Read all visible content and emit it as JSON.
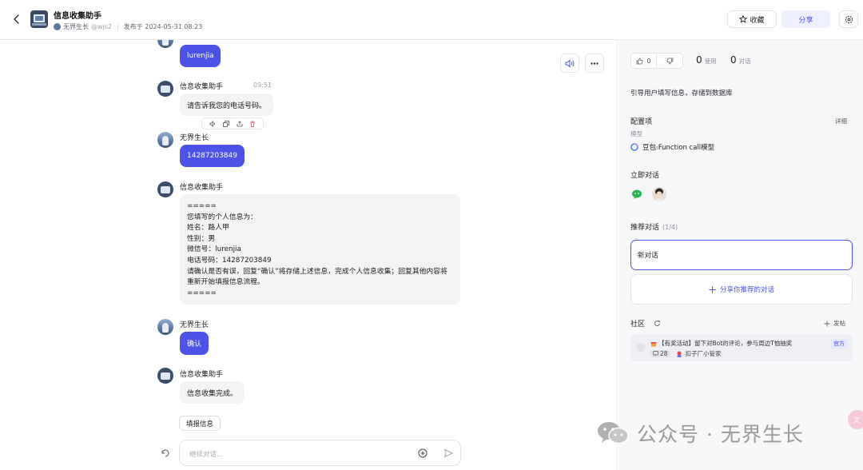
{
  "header": {
    "bot_name": "信息收集助手",
    "author": "无界生长",
    "handle": "@wjs2",
    "publish_time": "发布于 2024-05-31 08:23",
    "fav_label": "收藏",
    "share_label": "分享"
  },
  "chat": {
    "messages": [
      {
        "text": "lurenjia"
      },
      {
        "name": "信息收集助手",
        "time": "09:51",
        "text": "请告诉我您的电话号码。"
      },
      {
        "name": "无界生长",
        "text": "14287203849"
      },
      {
        "name": "信息收集助手",
        "lines": [
          "=====",
          "您填写的个人信息为：",
          "姓名：路人甲",
          "性别：男",
          "微信号：lurenjia",
          "电话号码：14287203849",
          "请确认是否有误，回复“确认”将存储上述信息，完成个人信息收集；回复其他内容将",
          "重新开始填报信息流程。",
          "====="
        ]
      },
      {
        "name": "无界生长",
        "text": "确认"
      },
      {
        "name": "信息收集助手",
        "text": "信息收集完成。"
      }
    ],
    "suggestion": "填报信息",
    "input_placeholder": "继续对话..."
  },
  "sidebar": {
    "likes": "0",
    "uses_count": "0",
    "uses_label": "使用",
    "convs_count": "0",
    "convs_label": "对话",
    "description": "引导用户填写信息，存储到数据库",
    "config_title": "配置项",
    "config_detail": "详细",
    "model_label": "模型",
    "model_name": "豆包·Function call模型",
    "instant_title": "立即对话",
    "recommend_title": "推荐对话",
    "recommend_count": "(1/4)",
    "new_conv": "新对话",
    "share_rec": "分享你推荐的对话",
    "community_title": "社区",
    "post_label": "发帖",
    "post_title": "【有奖活动】留下对Bot的评论，参与周边T恤抽奖",
    "post_badge": "官方",
    "post_comments": "28",
    "post_author": "扣子厂小管家"
  },
  "watermark": {
    "text": "公众号 · 无界生长"
  },
  "colors": {
    "accent": "#4d53e8",
    "bubble_gray": "#f2f3f5",
    "sidebar_bg": "#f7f7f9"
  }
}
